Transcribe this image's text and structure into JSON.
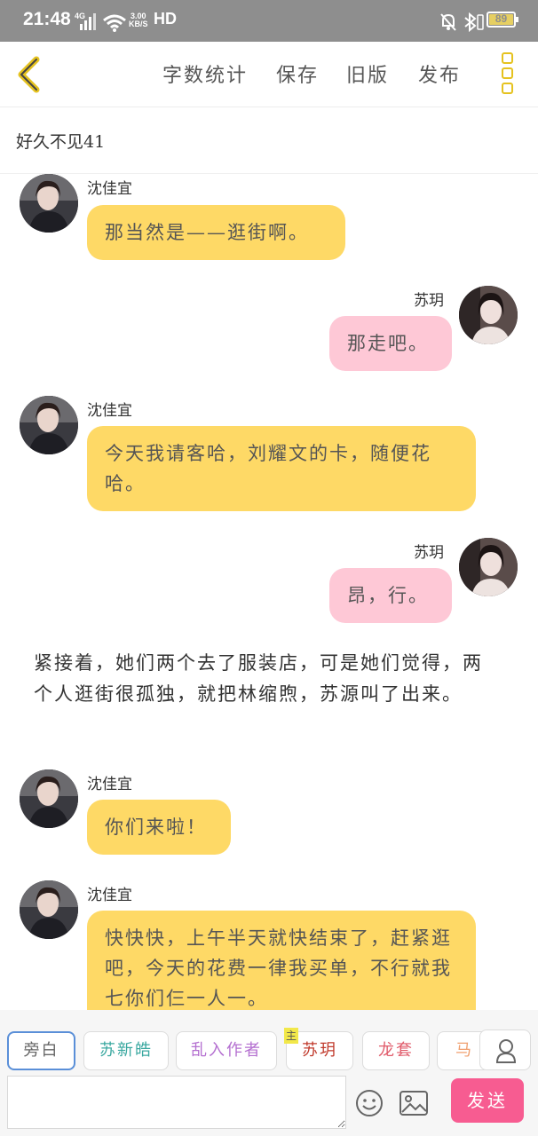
{
  "status_bar": {
    "time": "21:48",
    "signal_label": "4G",
    "speed_value": "3.00",
    "speed_unit": "KB/S",
    "hd_label": "HD",
    "battery": "89"
  },
  "header": {
    "word_count": "字数统计",
    "save": "保存",
    "old_version": "旧版",
    "publish": "发布"
  },
  "doc": {
    "title": "好久不见41"
  },
  "messages": [
    {
      "type": "left",
      "name": "沈佳宜",
      "color": "yellow",
      "text": "那当然是——逛街啊。"
    },
    {
      "type": "right",
      "name": "苏玥",
      "color": "pink",
      "text": "那走吧。"
    },
    {
      "type": "left",
      "name": "沈佳宜",
      "color": "yellow",
      "text": "今天我请客哈，刘耀文的卡，随便花哈。"
    },
    {
      "type": "right",
      "name": "苏玥",
      "color": "pink",
      "text": "昂，行。"
    },
    {
      "type": "narration",
      "text": "紧接着，她们两个去了服装店，可是她们觉得，两个人逛街很孤独，就把林缩煦，苏源叫了出来。"
    },
    {
      "type": "left",
      "name": "沈佳宜",
      "color": "yellow",
      "text": "你们来啦！"
    },
    {
      "type": "left",
      "name": "沈佳宜",
      "color": "yellow",
      "text": "快快快，上午半天就快结束了，赶紧逛吧，今天的花费一律我买单，不行就我七你们仨一人一。"
    }
  ],
  "roles": [
    {
      "label": "旁白",
      "color": "#666666",
      "selected": true
    },
    {
      "label": "苏新皓",
      "color": "#3aa8a0"
    },
    {
      "label": "乱入作者",
      "color": "#b46fd0"
    },
    {
      "label": "苏玥",
      "color": "#c0392b",
      "badge": "主"
    },
    {
      "label": "龙套",
      "color": "#e05a6a"
    },
    {
      "label": "马嘉",
      "color": "#f0a070"
    }
  ],
  "composer": {
    "placeholder": "",
    "send": "发送"
  },
  "colors": {
    "accent": "#e5c21f",
    "bubble_left": "#fed966",
    "bubble_right": "#fec8d6",
    "send": "#f75c91"
  }
}
